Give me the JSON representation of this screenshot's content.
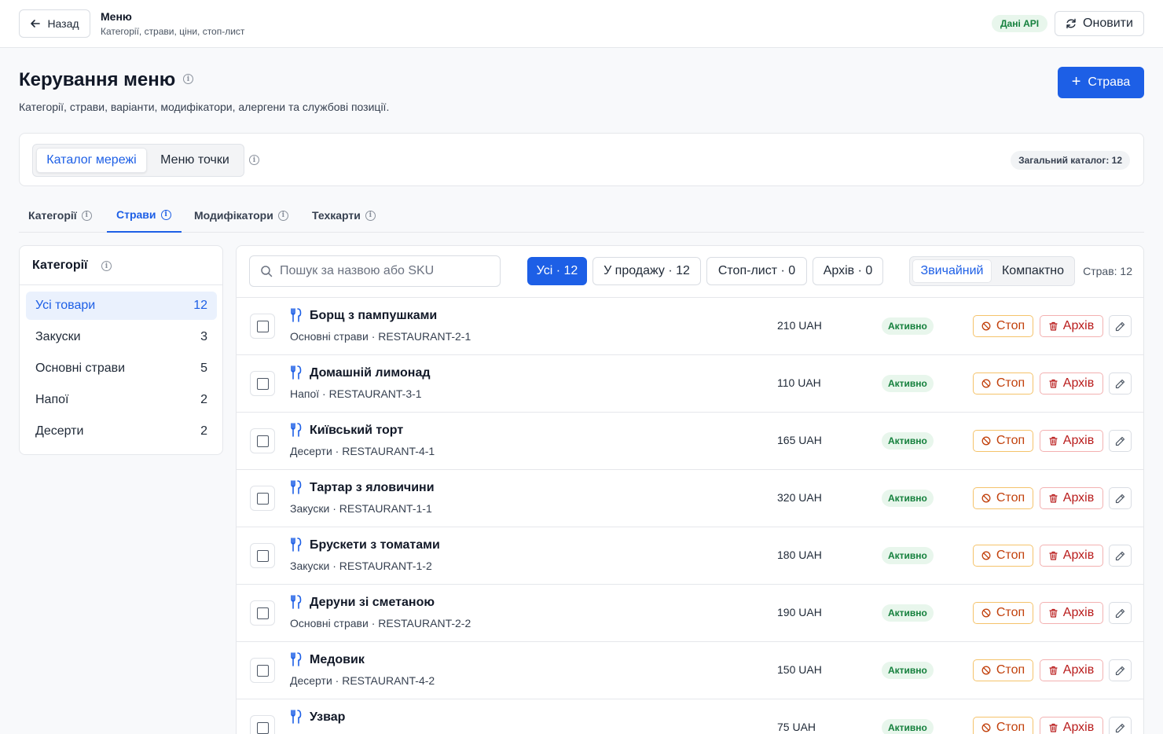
{
  "topbar": {
    "back_label": "Назад",
    "title": "Меню",
    "subtitle": "Категорії, страви, ціни, стоп-лист",
    "api_badge": "Дані API",
    "refresh_label": "Оновити"
  },
  "header": {
    "title": "Керування меню",
    "description": "Категорії, страви, варіанти, модифікатори, алергени та службові позиції.",
    "add_label": "Страва"
  },
  "catalog": {
    "modes": [
      "Каталог мережі",
      "Меню точки"
    ],
    "active_mode": "Каталог мережі",
    "total_badge": "Загальний каталог: 12"
  },
  "tabs": [
    {
      "label": "Категорії",
      "active": false
    },
    {
      "label": "Страви",
      "active": true
    },
    {
      "label": "Модифікатори",
      "active": false
    },
    {
      "label": "Техкарти",
      "active": false
    }
  ],
  "categories": {
    "title": "Категорії",
    "items": [
      {
        "label": "Усі товари",
        "count": "12",
        "active": true
      },
      {
        "label": "Закуски",
        "count": "3",
        "active": false
      },
      {
        "label": "Основні страви",
        "count": "5",
        "active": false
      },
      {
        "label": "Напої",
        "count": "2",
        "active": false
      },
      {
        "label": "Десерти",
        "count": "2",
        "active": false
      }
    ]
  },
  "toolbar": {
    "search_placeholder": "Пошук за назвою або SKU",
    "filters": [
      {
        "label": "Усі · 12",
        "active": true
      },
      {
        "label": "У продажу · 12",
        "active": false
      },
      {
        "label": "Стоп-лист · 0",
        "active": false
      },
      {
        "label": "Архів · 0",
        "active": false
      }
    ],
    "views": [
      "Звичайний",
      "Компактно"
    ],
    "active_view": "Звичайний",
    "dish_count": "Страв: 12"
  },
  "dishes": [
    {
      "name": "Борщ з пампушками",
      "meta": "Основні страви · RESTAURANT-2-1",
      "price": "210 UAH",
      "status": "Активно"
    },
    {
      "name": "Домашній лимонад",
      "meta": "Напої · RESTAURANT-3-1",
      "price": "110 UAH",
      "status": "Активно"
    },
    {
      "name": "Київський торт",
      "meta": "Десерти · RESTAURANT-4-1",
      "price": "165 UAH",
      "status": "Активно"
    },
    {
      "name": "Тартар з яловичини",
      "meta": "Закуски · RESTAURANT-1-1",
      "price": "320 UAH",
      "status": "Активно"
    },
    {
      "name": "Брускети з томатами",
      "meta": "Закуски · RESTAURANT-1-2",
      "price": "180 UAH",
      "status": "Активно"
    },
    {
      "name": "Деруни зі сметаною",
      "meta": "Основні страви · RESTAURANT-2-2",
      "price": "190 UAH",
      "status": "Активно"
    },
    {
      "name": "Медовик",
      "meta": "Десерти · RESTAURANT-4-2",
      "price": "150 UAH",
      "status": "Активно"
    },
    {
      "name": "Узвар",
      "meta": "",
      "price": "75 UAH",
      "status": "Активно"
    }
  ],
  "row_actions": {
    "stop_label": "Стоп",
    "archive_label": "Архів"
  },
  "colors": {
    "accent": "#1d5fe6",
    "success": "#15803d",
    "warning": "#c2410c",
    "danger": "#b91c1c"
  },
  "icons": {
    "back": "arrow-left-icon",
    "refresh": "refresh-icon",
    "info": "info-icon",
    "search": "search-icon",
    "dish": "utensils-icon",
    "stop": "ban-icon",
    "archive": "trash-icon",
    "edit": "pencil-icon"
  }
}
